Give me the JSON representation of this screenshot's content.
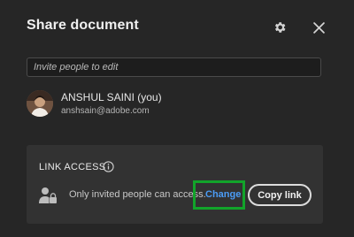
{
  "dialog": {
    "title": "Share document"
  },
  "header": {
    "settings_icon": "gear-icon",
    "close_icon": "close-icon"
  },
  "invite": {
    "placeholder": "Invite people to edit",
    "value": ""
  },
  "user": {
    "name": "ANSHUL SAINI (you)",
    "email": "anshsain@adobe.com",
    "avatar_icon": "avatar"
  },
  "link_access": {
    "heading": "LINK ACCESS",
    "info_icon": "info-icon",
    "access_icon": "person-lock-icon",
    "status_text": "Only invited people can access.",
    "change_label": "Change",
    "copy_label": "Copy link"
  },
  "colors": {
    "background": "#262626",
    "panel": "#323232",
    "link": "#4b9cf5",
    "highlight": "#12a42a"
  }
}
